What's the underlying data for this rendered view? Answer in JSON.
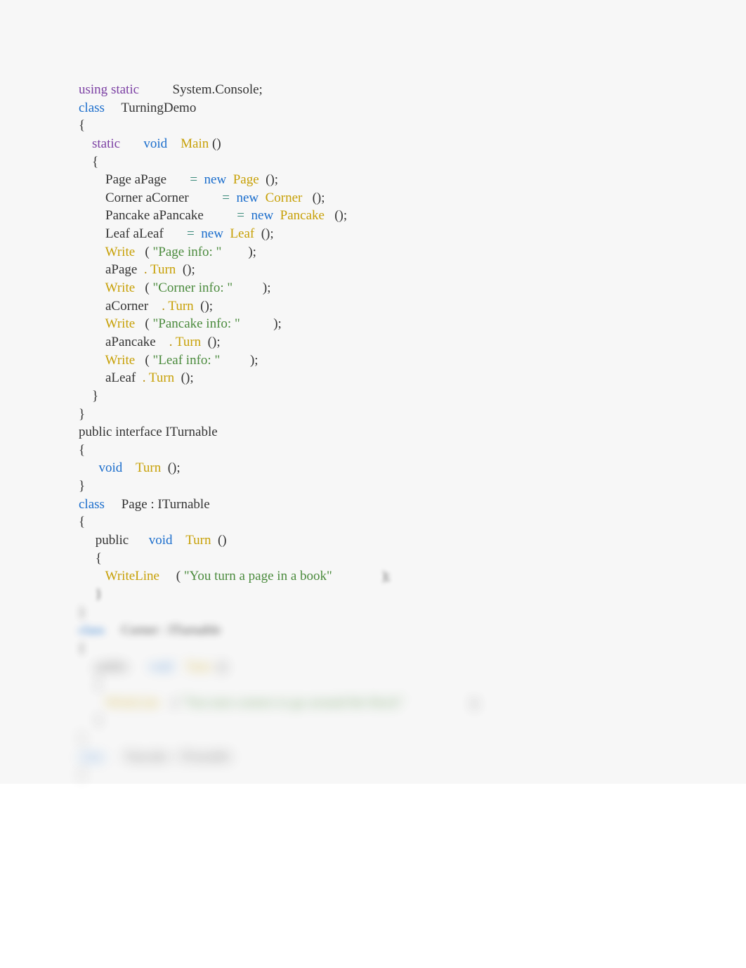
{
  "code": {
    "l1_using": "using",
    "l1_static": "static",
    "l1_system": "          System.Console;",
    "l2_class": "class",
    "l2_name": "     TurningDemo",
    "l3": "{",
    "l4_static": "static",
    "l4_void": "void",
    "l4_main": "Main",
    "l4_parens": " ()",
    "l5": "    {",
    "l6a": "        Page aPage       ",
    "l6_eq": "=  ",
    "l6_new": "new",
    "l6_type": "Page",
    "l6_end": "  ();",
    "l7a": "        Corner aCorner          ",
    "l7_eq": "=  ",
    "l7_new": "new",
    "l7_type": "Corner",
    "l7_end": "   ();",
    "l8a": "        Pancake aPancake          ",
    "l8_eq": "=  ",
    "l8_new": "new",
    "l8_type": "Pancake",
    "l8_end": "   ();",
    "l9a": "        Leaf aLeaf       ",
    "l9_eq": "=  ",
    "l9_new": "new",
    "l9_type": "Leaf",
    "l9_end": "  ();",
    "l10_write": "Write",
    "l10_open": "   ( ",
    "l10_str": "\"Page info: \"",
    "l10_end": "        );",
    "l11a": "        aPage  ",
    "l11_dot": ". ",
    "l11_turn": "Turn",
    "l11_end": "  ();",
    "l12_write": "Write",
    "l12_open": "   ( ",
    "l12_str": "\"Corner info: \"",
    "l12_end": "         );",
    "l13a": "        aCorner    ",
    "l13_dot": ". ",
    "l13_turn": "Turn",
    "l13_end": "  ();",
    "l14_write": "Write",
    "l14_open": "   ( ",
    "l14_str": "\"Pancake info: \"",
    "l14_end": "          );",
    "l15a": "        aPancake    ",
    "l15_dot": ". ",
    "l15_turn": "Turn",
    "l15_end": "  ();",
    "l16_write": "Write",
    "l16_open": "   ( ",
    "l16_str": "\"Leaf info: \"",
    "l16_end": "         );",
    "l17a": "        aLeaf  ",
    "l17_dot": ". ",
    "l17_turn": "Turn",
    "l17_end": "  ();",
    "l18": "    }",
    "l19": "}",
    "l20": "public interface ITurnable",
    "l21": "{",
    "l22_void": "void",
    "l22_turn": "Turn",
    "l22_end": "  ();",
    "l23": "}",
    "l24_class": "class",
    "l24_name": "     Page : ITurnable",
    "l25": "{",
    "l26_public": "     public      ",
    "l26_void": "void",
    "l26_turn": "Turn",
    "l26_end": "  ()",
    "l27": "     {",
    "l28_wl": "WriteLine",
    "l28_open": "     ( ",
    "l28_str": "\"You turn a page in a book\"",
    "l28_end": "               );",
    "l29": "     }",
    "l30": "}",
    "l31_class": "class",
    "l31_name": "     Corner : ITurnable",
    "l32": "{",
    "l33_public": "     public      ",
    "l33_void": "void",
    "l33_turn": "Turn",
    "l33_end": "  ()",
    "l34": "     {",
    "l35_wl": "WriteLine",
    "l35_open": "    ( ",
    "l35_str": "\"You turn corners to go around the block\"",
    "l35_end": "                    );",
    "l36": "     }",
    "l37": "}",
    "l38_class": "class",
    "l38_name": "      Pancake : ITurnable",
    "l39": "{"
  }
}
